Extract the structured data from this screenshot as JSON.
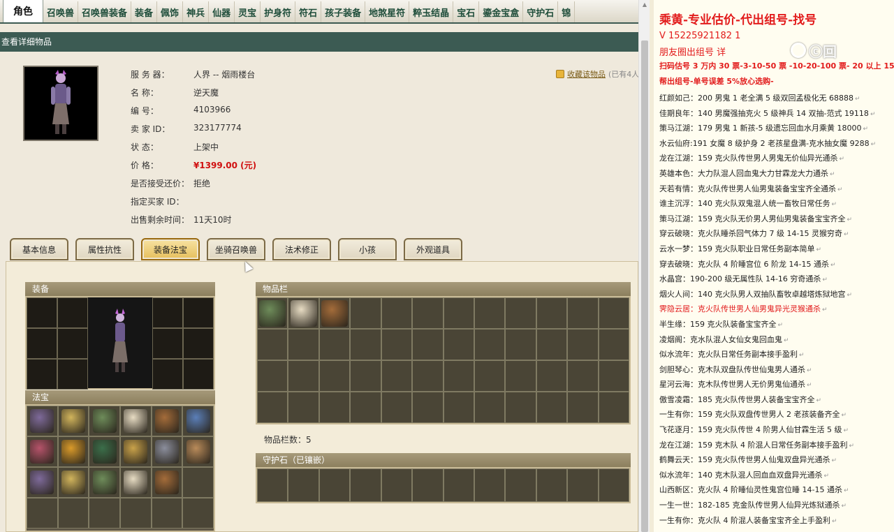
{
  "topnav": {
    "tabs": [
      "角色",
      "召唤兽",
      "召唤兽装备",
      "装备",
      "佩饰",
      "神兵",
      "仙器",
      "灵宝",
      "护身符",
      "符石",
      "孩子装备",
      "地煞星符",
      "粹玉结晶",
      "宝石",
      "鎏金宝盒",
      "守护石",
      "锦"
    ]
  },
  "title": "查看详细物品",
  "info": {
    "server_label": "服 务 器：",
    "server": "人界 -- 烟雨楼台",
    "name_label": "名        称：",
    "name": "逆天魔",
    "id_label": "编        号：",
    "id": "4103966",
    "seller_label": "卖  家  ID：",
    "seller": "323177774",
    "status_label": "状        态：",
    "status": "上架中",
    "price_label": "价        格：",
    "price": "¥1399.00 (元)",
    "bargain_label": "是否接受还价：",
    "bargain": "拒绝",
    "buyer_label": "指定买家 ID：",
    "buyer": "",
    "time_label": "出售剩余时间：",
    "time": "11天10时"
  },
  "favorite": {
    "link": "收藏该物品",
    "count": "(已有4人)"
  },
  "subtabs": [
    "基本信息",
    "属性抗性",
    "装备法宝",
    "坐骑召唤兽",
    "法术修正",
    "小孩",
    "外观道具"
  ],
  "panels": {
    "equip": "装备",
    "fabao": "法宝",
    "inventory": "物品栏",
    "inventory_count": "物品栏数：5",
    "guard_stone": "守护石（已镶嵌）"
  },
  "colors": {
    "accent_red": "#e21b1b",
    "header_green": "#3c5b53"
  },
  "notes": {
    "title": "乘黄-专业估价-代出组号-找号",
    "phone": "V 15225921182    1",
    "friend": "朋友圈出组号    详",
    "rule1": "扫码估号 3 万内 30 票-3-10-50 票  -10-20-100 票- 20 以上 150",
    "rule2": "帮出组号-单号误差 5%放心选购-",
    "lines": [
      "红颜如己：200 男鬼 1 老全满 5 级双回孟极化无  68888",
      "佳期良年：140 男魔强抽克火 5 级神兵 14 双抽-范式 19118",
      "策马江湖：179 男鬼 1 新孩-5 级遗忘回血水月乘黄 18000",
      "水云仙府:191 女魔 8 级护身 2 老孩星盘满-克水抽女魔 9288",
      "龙在江湖：159 克火队传世男人男鬼无价仙异光通杀",
      "英雄本色：大力队混人回血鬼大力甘霖龙大力通杀",
      "天若有情：克火队传世男人仙男鬼装备宝宝齐全通杀",
      "谁主沉浮：140 克火队双鬼混人统一畜牧日常任务",
      "策马江湖：159 克火队无价男人男仙男鬼装备宝宝齐全",
      "穿云破晓：克火队睡杀回气体力 7 级 14-15 灵猴穷奇",
      "云水一梦：159 克火队职业日常任务副本简单",
      "穿去破晓：克火队 4 阶睡宫位 6 阶龙 14-15 通杀",
      "水晶宫：190-200 级无属性队 14-16 穷奇通杀",
      "烟火人间：140 克火队男人双抽队畜牧卓越塔炼狱地宫",
      "霁隐云居：克火队传世男人仙男鬼异光灵猴通杀",
      "半生缘：159 克火队装备宝宝齐全",
      "凌烟阁：克水队混人女仙女鬼回血鬼",
      "似水流年：克火队日常任务副本接手盈利",
      "剑胆琴心：克木队双盘队传世仙鬼男人通杀",
      "星河云海：克木队传世男人无价男鬼仙通杀",
      "傲雪凌霜：185 克火队传世男人装备宝宝齐全",
      "一生有你：159 克火队双盘传世男人 2 老孩装备齐全",
      "飞花逐月：159 克火队传世 4 阶男人仙甘霖生活 5 级",
      "龙在江湖：159 克木队 4 阶混人日常任务副本接手盈利",
      "鹤舞云天：159 克火队传世男人仙鬼双盘异光通杀",
      "似水流年：140 克木队混人回血血双盘异光通杀",
      "山西新区：克火队 4 阶睡仙灵性鬼宫位睡 14-15 通杀",
      "一生一世：182-185 克金队传世男人仙异光炼狱通杀",
      "一生有你：克火队 4 阶混人装备宝宝齐全上手盈利"
    ],
    "watermark": "ⓒ回"
  }
}
